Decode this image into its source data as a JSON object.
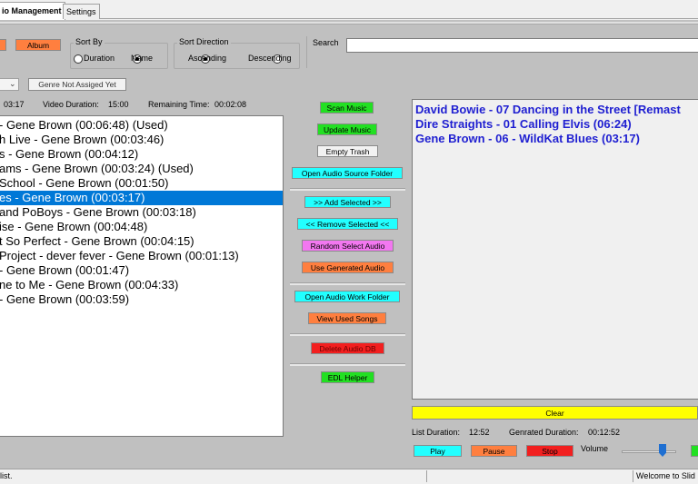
{
  "tabs": [
    {
      "label": "io Management"
    },
    {
      "label": "Settings"
    }
  ],
  "filters": {
    "album_button": "Album",
    "sort_by": {
      "title": "Sort By",
      "options": [
        "Duration",
        "Name"
      ],
      "selected": "Name"
    },
    "sort_direction": {
      "title": "Sort Direction",
      "options": [
        "Ascending",
        "Descending"
      ],
      "selected": "Ascending"
    },
    "search": {
      "label": "Search",
      "value": ""
    },
    "genre_button": "Genre Not Assiged Yet"
  },
  "info": {
    "count_partial": "03:17",
    "video_duration_label": "Video Duration:",
    "video_duration": "15:00",
    "remaining_label": "Remaining Time:",
    "remaining": "00:02:08"
  },
  "songs": [
    {
      "text": "- Gene Brown (00:06:48) (Used)",
      "selected": false
    },
    {
      "text": "h Live - Gene Brown (00:03:46)",
      "selected": false
    },
    {
      "text": "s - Gene Brown (00:04:12)",
      "selected": false
    },
    {
      "text": "ams - Gene Brown (00:03:24) (Used)",
      "selected": false
    },
    {
      "text": "School - Gene Brown (00:01:50)",
      "selected": false
    },
    {
      "text": "es - Gene Brown (00:03:17)",
      "selected": true
    },
    {
      "text": "and PoBoys - Gene Brown (00:03:18)",
      "selected": false
    },
    {
      "text": "ise - Gene Brown (00:04:48)",
      "selected": false
    },
    {
      "text": "t So Perfect - Gene Brown (00:04:15)",
      "selected": false
    },
    {
      "text": "Project - dever fever - Gene Brown (00:01:13)",
      "selected": false
    },
    {
      "text": "- Gene Brown (00:01:47)",
      "selected": false
    },
    {
      "text": "ne to Me - Gene Brown (00:04:33)",
      "selected": false
    },
    {
      "text": "- Gene Brown (00:03:59)",
      "selected": false
    }
  ],
  "actions": {
    "scan_music": "Scan Music",
    "update_music": "Update Music",
    "empty_trash": "Empty Trash",
    "open_audio_source_folder": "Open Audio Source Folder",
    "add_selected": ">> Add Selected >>",
    "remove_selected": "<< Remove Selected <<",
    "random_select_audio": "Random Select Audio",
    "use_generated_audio": "Use Generated Audio",
    "open_audio_work_folder": "Open Audio Work Folder",
    "view_used_songs": "View Used Songs",
    "delete_audio_db": "Delete Audio DB",
    "edl_helper": "EDL Helper"
  },
  "playlist": [
    "David Bowie - 07 Dancing in the Street [Remast",
    "Dire Straights - 01 Calling Elvis (06:24)",
    "Gene Brown - 06 - WildKat Blues (03:17)"
  ],
  "playlist_controls": {
    "clear": "Clear",
    "list_duration_label": "List Duration:",
    "list_duration": "12:52",
    "generated_duration_label": "Genrated Duration:",
    "generated_duration": "00:12:52",
    "play": "Play",
    "pause": "Pause",
    "stop": "Stop",
    "volume_label": "Volume",
    "volume_level": 0.74
  },
  "status": {
    "left": "list.",
    "right": "Welcome to Slid"
  },
  "colors": {
    "orange": "#ff7f3f",
    "green": "#22e022",
    "cyan": "#22ffff",
    "magenta": "#f277f0",
    "red": "#f21f1f",
    "yellow": "#ffff00",
    "select_blue": "#0078d7",
    "playlist_text": "#1f1fd1"
  }
}
